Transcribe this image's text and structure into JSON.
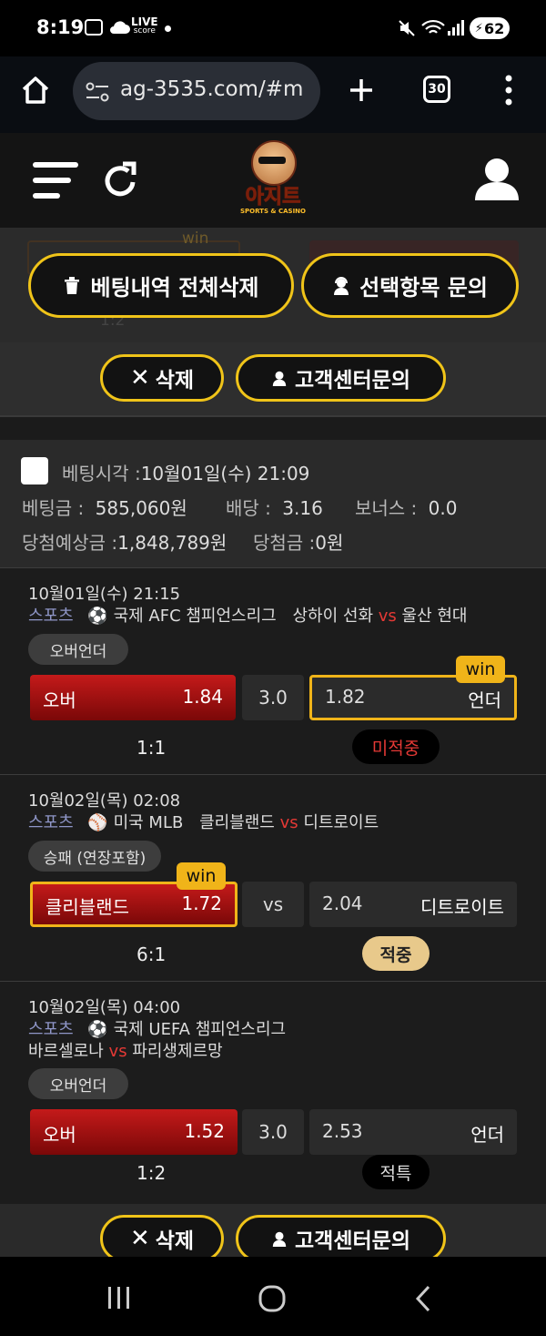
{
  "status_bar": {
    "time": "8:19",
    "live_label": "LIVE",
    "live_sub": "score",
    "battery": "62"
  },
  "browser": {
    "url": "ag-3535.com/#m",
    "tab_count": "30"
  },
  "site": {
    "logo_text": "아지트",
    "logo_sub": "SPORTS & CASINO"
  },
  "top_actions": {
    "delete_all": "베팅내역 전체삭제",
    "inquire_selected": "선택항목 문의",
    "delete": "삭제",
    "cs_inquiry": "고객센터문의",
    "hidden_tag": "win",
    "hidden_text": "1:2"
  },
  "bet": {
    "time_label": "베팅시각 :",
    "time_value": "10월01일(수) 21:09",
    "amount_label": "베팅금 :",
    "amount_value": "585,060원",
    "odds_label": "배당 :",
    "odds_value": "3.16",
    "bonus_label": "보너스 :",
    "bonus_value": "0.0",
    "expected_label": "당첨예상금 :",
    "expected_value": "1,848,789원",
    "won_label": "당첨금 :",
    "won_value": "0원"
  },
  "matches": [
    {
      "date": "10월01일(수) 21:15",
      "sport": "스포츠",
      "league": "국제 AFC 챔피언스리그",
      "home": "상하이 선화",
      "vs": "vs",
      "away": "울산 현대",
      "market": "오버언더",
      "left_label": "오버",
      "left_odds": "1.84",
      "mid": "3.0",
      "right_odds": "1.82",
      "right_label": "언더",
      "win_tag": "win",
      "score": "1:1",
      "result": "미적중"
    },
    {
      "date": "10월02일(목) 02:08",
      "sport": "스포츠",
      "league": "미국 MLB",
      "home": "클리블랜드",
      "vs": "vs",
      "away": "디트로이트",
      "market": "승패 (연장포함)",
      "left_label": "클리블랜드",
      "left_odds": "1.72",
      "mid": "vs",
      "right_odds": "2.04",
      "right_label": "디트로이트",
      "win_tag": "win",
      "score": "6:1",
      "result": "적중"
    },
    {
      "date": "10월02일(목) 04:00",
      "sport": "스포츠",
      "league": "국제 UEFA 챔피언스리그",
      "home": "바르셀로나",
      "vs": "vs",
      "away": "파리생제르망",
      "market": "오버언더",
      "left_label": "오버",
      "left_odds": "1.52",
      "mid": "3.0",
      "right_odds": "2.53",
      "right_label": "언더",
      "score": "1:2",
      "result": "적특"
    }
  ],
  "bottom_actions": {
    "delete": "삭제",
    "cs_inquiry": "고객센터문의"
  },
  "colors": {
    "accent": "#f0c419",
    "win": "#f0b419",
    "red": "#c41a1a",
    "sport": "#8f96c8"
  }
}
